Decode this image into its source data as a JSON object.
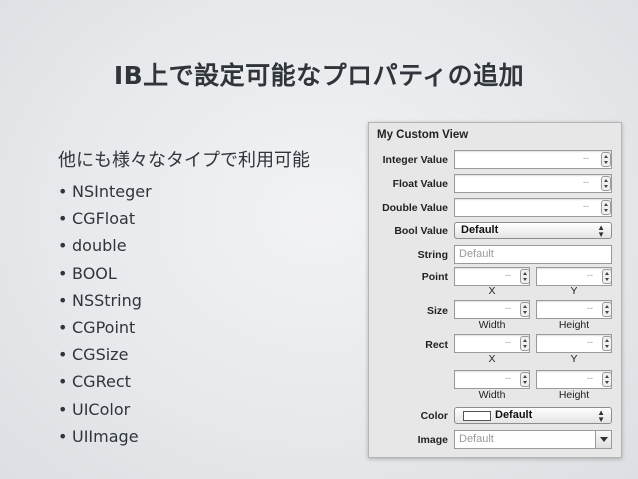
{
  "slide": {
    "title": "IB上で設定可能なプロパティの追加",
    "intro": "他にも様々なタイプで利用可能",
    "bullets": [
      "NSInteger",
      "CGFloat",
      "double",
      "BOOL",
      "NSString",
      "CGPoint",
      "CGSize",
      "CGRect",
      "UIColor",
      "UIImage"
    ]
  },
  "panel": {
    "header": "My Custom View",
    "labels": {
      "integer": "Integer Value",
      "float": "Float Value",
      "double": "Double Value",
      "bool": "Bool Value",
      "string": "String",
      "point": "Point",
      "size": "Size",
      "rect": "Rect",
      "color": "Color",
      "image": "Image"
    },
    "dash": "--",
    "bool_value": "Default",
    "string_placeholder": "Default",
    "x_label": "X",
    "y_label": "Y",
    "width_label": "Width",
    "height_label": "Height",
    "color_value": "Default",
    "image_placeholder": "Default",
    "popup_arrows": "⌃⌄"
  }
}
